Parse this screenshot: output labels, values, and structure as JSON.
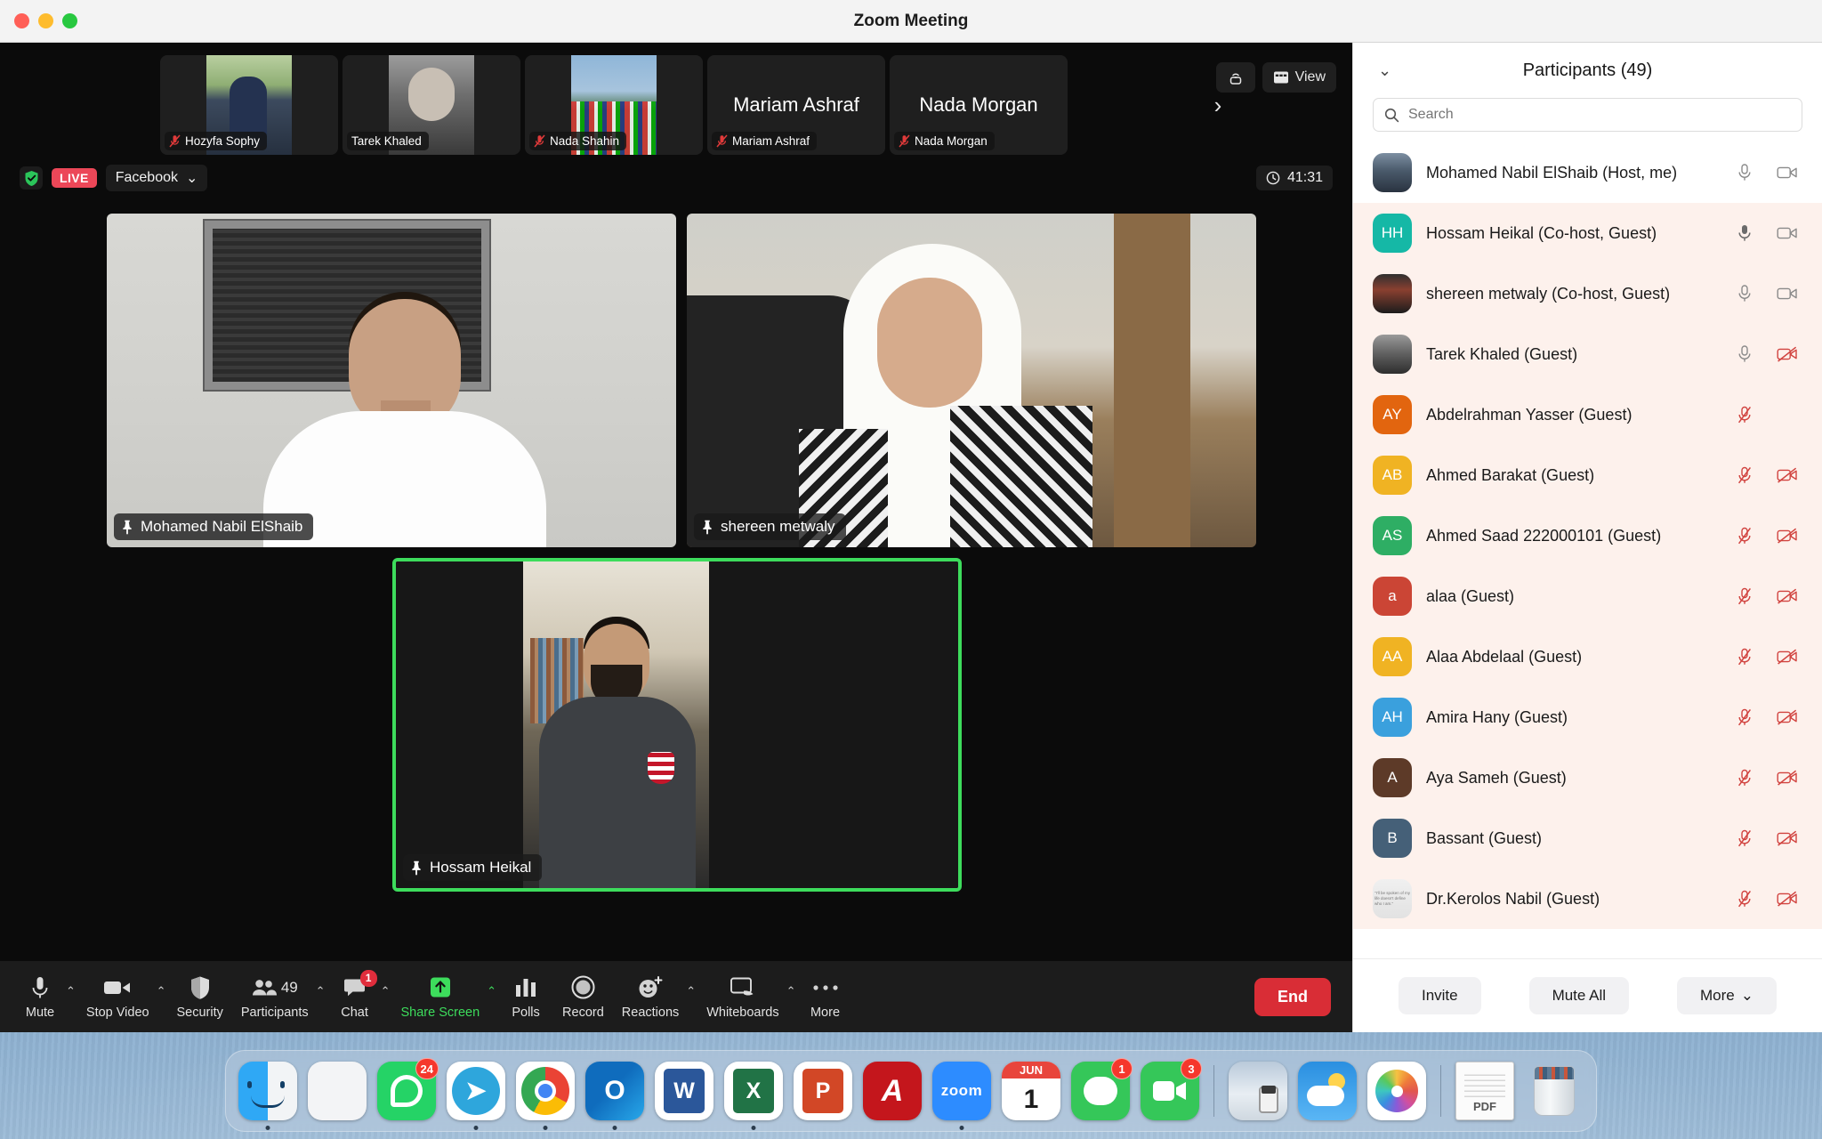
{
  "window": {
    "title": "Zoom Meeting"
  },
  "filmstrip": {
    "tiles": [
      {
        "name": "Hozyfa Sophy",
        "label": "Hozyfa Sophy",
        "muted": true,
        "has_video": true,
        "placeholder": ""
      },
      {
        "name": "Tarek Khaled",
        "label": "Tarek Khaled",
        "muted": false,
        "has_video": true,
        "placeholder": ""
      },
      {
        "name": "Nada Shahin",
        "label": "Nada Shahin",
        "muted": true,
        "has_video": true,
        "placeholder": ""
      },
      {
        "name": "Mariam Ashraf",
        "label": "Mariam Ashraf",
        "muted": true,
        "has_video": false,
        "placeholder": "Mariam Ashraf"
      },
      {
        "name": "Nada Morgan",
        "label": "Nada Morgan",
        "muted": true,
        "has_video": false,
        "placeholder": "Nada Morgan"
      }
    ],
    "next_arrow": "›",
    "speaker_view_icon": "speaker-view-icon",
    "view_button": "View"
  },
  "livebar": {
    "shield_icon": "shield-check-icon",
    "live_label": "LIVE",
    "platform": "Facebook",
    "platform_caret": "⌄",
    "timer": "41:31",
    "clock_icon": "clock-icon"
  },
  "stage": {
    "tiles": [
      {
        "name": "Mohamed Nabil ElShaib",
        "pinned": true,
        "active_speaker": false
      },
      {
        "name": "shereen metwaly",
        "pinned": true,
        "active_speaker": false
      },
      {
        "name": "Hossam Heikal",
        "pinned": true,
        "active_speaker": true
      }
    ],
    "active_border_color": "#3ddc5c"
  },
  "toolbar": {
    "items": [
      {
        "label": "Mute",
        "icon": "microphone-icon",
        "caret": true,
        "badge": null,
        "highlight": false
      },
      {
        "label": "Stop Video",
        "icon": "video-camera-icon",
        "caret": true,
        "badge": null,
        "highlight": false
      },
      {
        "label": "Security",
        "icon": "shield-icon",
        "caret": false,
        "badge": null,
        "highlight": false
      },
      {
        "label": "Participants",
        "icon": "people-icon",
        "caret": true,
        "badge": null,
        "count": "49",
        "highlight": false
      },
      {
        "label": "Chat",
        "icon": "chat-bubble-icon",
        "caret": true,
        "badge": "1",
        "highlight": false
      },
      {
        "label": "Share Screen",
        "icon": "share-screen-icon",
        "caret": true,
        "badge": null,
        "highlight": true
      },
      {
        "label": "Polls",
        "icon": "polls-bars-icon",
        "caret": false,
        "badge": null,
        "highlight": false
      },
      {
        "label": "Record",
        "icon": "record-circle-icon",
        "caret": false,
        "badge": null,
        "highlight": false
      },
      {
        "label": "Reactions",
        "icon": "reactions-smiley-icon",
        "caret": true,
        "badge": null,
        "highlight": false
      },
      {
        "label": "Whiteboards",
        "icon": "whiteboard-icon",
        "caret": true,
        "badge": null,
        "highlight": false
      },
      {
        "label": "More",
        "icon": "more-dots-icon",
        "caret": false,
        "badge": null,
        "highlight": false
      }
    ],
    "end_button": "End",
    "end_color": "#d92d36",
    "share_color": "#3ddc5c"
  },
  "panel": {
    "chevron": "⌄",
    "title": "Participants (49)",
    "search": {
      "placeholder": "Search",
      "value": "",
      "icon": "search-icon"
    },
    "participants": [
      {
        "name": "Mohamed Nabil ElShaib (Host, me)",
        "initials": "",
        "avatar_type": "photo",
        "avatar_color": "#6b7f95",
        "mic": "on-outline",
        "cam": "on",
        "row": "white"
      },
      {
        "name": "Hossam Heikal (Co-host, Guest)",
        "initials": "HH",
        "avatar_type": "initials",
        "avatar_color": "#15b8a6",
        "mic": "speaking",
        "cam": "on",
        "row": "tint"
      },
      {
        "name": "shereen metwaly (Co-host, Guest)",
        "initials": "",
        "avatar_type": "photo",
        "avatar_color": "#7a4a3a",
        "mic": "on-outline",
        "cam": "on",
        "row": "tint"
      },
      {
        "name": "Tarek Khaled (Guest)",
        "initials": "",
        "avatar_type": "photo",
        "avatar_color": "#6e6e6e",
        "mic": "on-outline",
        "cam": "off",
        "row": "tint"
      },
      {
        "name": "Abdelrahman Yasser (Guest)",
        "initials": "AY",
        "avatar_type": "initials",
        "avatar_color": "#e2650f",
        "mic": "off",
        "cam": "none",
        "row": "tint"
      },
      {
        "name": "Ahmed Barakat (Guest)",
        "initials": "AB",
        "avatar_type": "initials",
        "avatar_color": "#f0b323",
        "mic": "off",
        "cam": "off",
        "row": "tint"
      },
      {
        "name": "Ahmed Saad 222000101 (Guest)",
        "initials": "AS",
        "avatar_type": "initials",
        "avatar_color": "#2eae64",
        "mic": "off",
        "cam": "off",
        "row": "tint"
      },
      {
        "name": "alaa (Guest)",
        "initials": "a",
        "avatar_type": "initials",
        "avatar_color": "#cb4535",
        "mic": "off",
        "cam": "off",
        "row": "tint"
      },
      {
        "name": "Alaa Abdelaal (Guest)",
        "initials": "AA",
        "avatar_type": "initials",
        "avatar_color": "#f0b323",
        "mic": "off",
        "cam": "off",
        "row": "tint"
      },
      {
        "name": "Amira Hany (Guest)",
        "initials": "AH",
        "avatar_type": "initials",
        "avatar_color": "#3aa0dd",
        "mic": "off",
        "cam": "off",
        "row": "tint"
      },
      {
        "name": "Aya Sameh (Guest)",
        "initials": "A",
        "avatar_type": "initials",
        "avatar_color": "#5d3a28",
        "mic": "off",
        "cam": "off",
        "row": "tint"
      },
      {
        "name": "Bassant (Guest)",
        "initials": "B",
        "avatar_type": "initials",
        "avatar_color": "#456078",
        "mic": "off",
        "cam": "off",
        "row": "tint"
      },
      {
        "name": "Dr.Kerolos Nabil (Guest)",
        "initials": "",
        "avatar_type": "photo",
        "avatar_color": "#ebebeb",
        "mic": "off",
        "cam": "off",
        "row": "tint"
      }
    ],
    "footer": {
      "invite": "Invite",
      "mute_all": "Mute All",
      "more": "More",
      "more_caret": "⌄"
    }
  },
  "dock": {
    "items": [
      {
        "name": "finder",
        "label": "F",
        "badge": null,
        "running": true
      },
      {
        "name": "launchpad",
        "label": "",
        "badge": null,
        "running": false
      },
      {
        "name": "whatsapp",
        "label": "",
        "badge": "24",
        "running": false
      },
      {
        "name": "telegram",
        "label": "",
        "badge": null,
        "running": true
      },
      {
        "name": "chrome",
        "label": "",
        "badge": null,
        "running": true
      },
      {
        "name": "outlook",
        "label": "O",
        "badge": null,
        "running": true
      },
      {
        "name": "word",
        "label": "W",
        "badge": null,
        "running": false
      },
      {
        "name": "excel",
        "label": "X",
        "badge": null,
        "running": true
      },
      {
        "name": "powerpoint",
        "label": "P",
        "badge": null,
        "running": false
      },
      {
        "name": "acrobat",
        "label": "",
        "badge": null,
        "running": false
      },
      {
        "name": "zoom",
        "label": "zoom",
        "badge": null,
        "running": true
      },
      {
        "name": "calendar",
        "label": "1",
        "badge": null,
        "running": false,
        "month": "JUN"
      },
      {
        "name": "messages",
        "label": "",
        "badge": "1",
        "running": false
      },
      {
        "name": "facetime",
        "label": "",
        "badge": "3",
        "running": false
      },
      {
        "name": "separator",
        "label": "",
        "badge": null,
        "running": false
      },
      {
        "name": "preview",
        "label": "",
        "badge": null,
        "running": false
      },
      {
        "name": "weather",
        "label": "",
        "badge": null,
        "running": false
      },
      {
        "name": "photos",
        "label": "",
        "badge": null,
        "running": false
      },
      {
        "name": "separator",
        "label": "",
        "badge": null,
        "running": false
      },
      {
        "name": "pdf-file",
        "label": "PDF",
        "badge": null,
        "running": false
      },
      {
        "name": "trash",
        "label": "",
        "badge": null,
        "running": false
      }
    ]
  }
}
